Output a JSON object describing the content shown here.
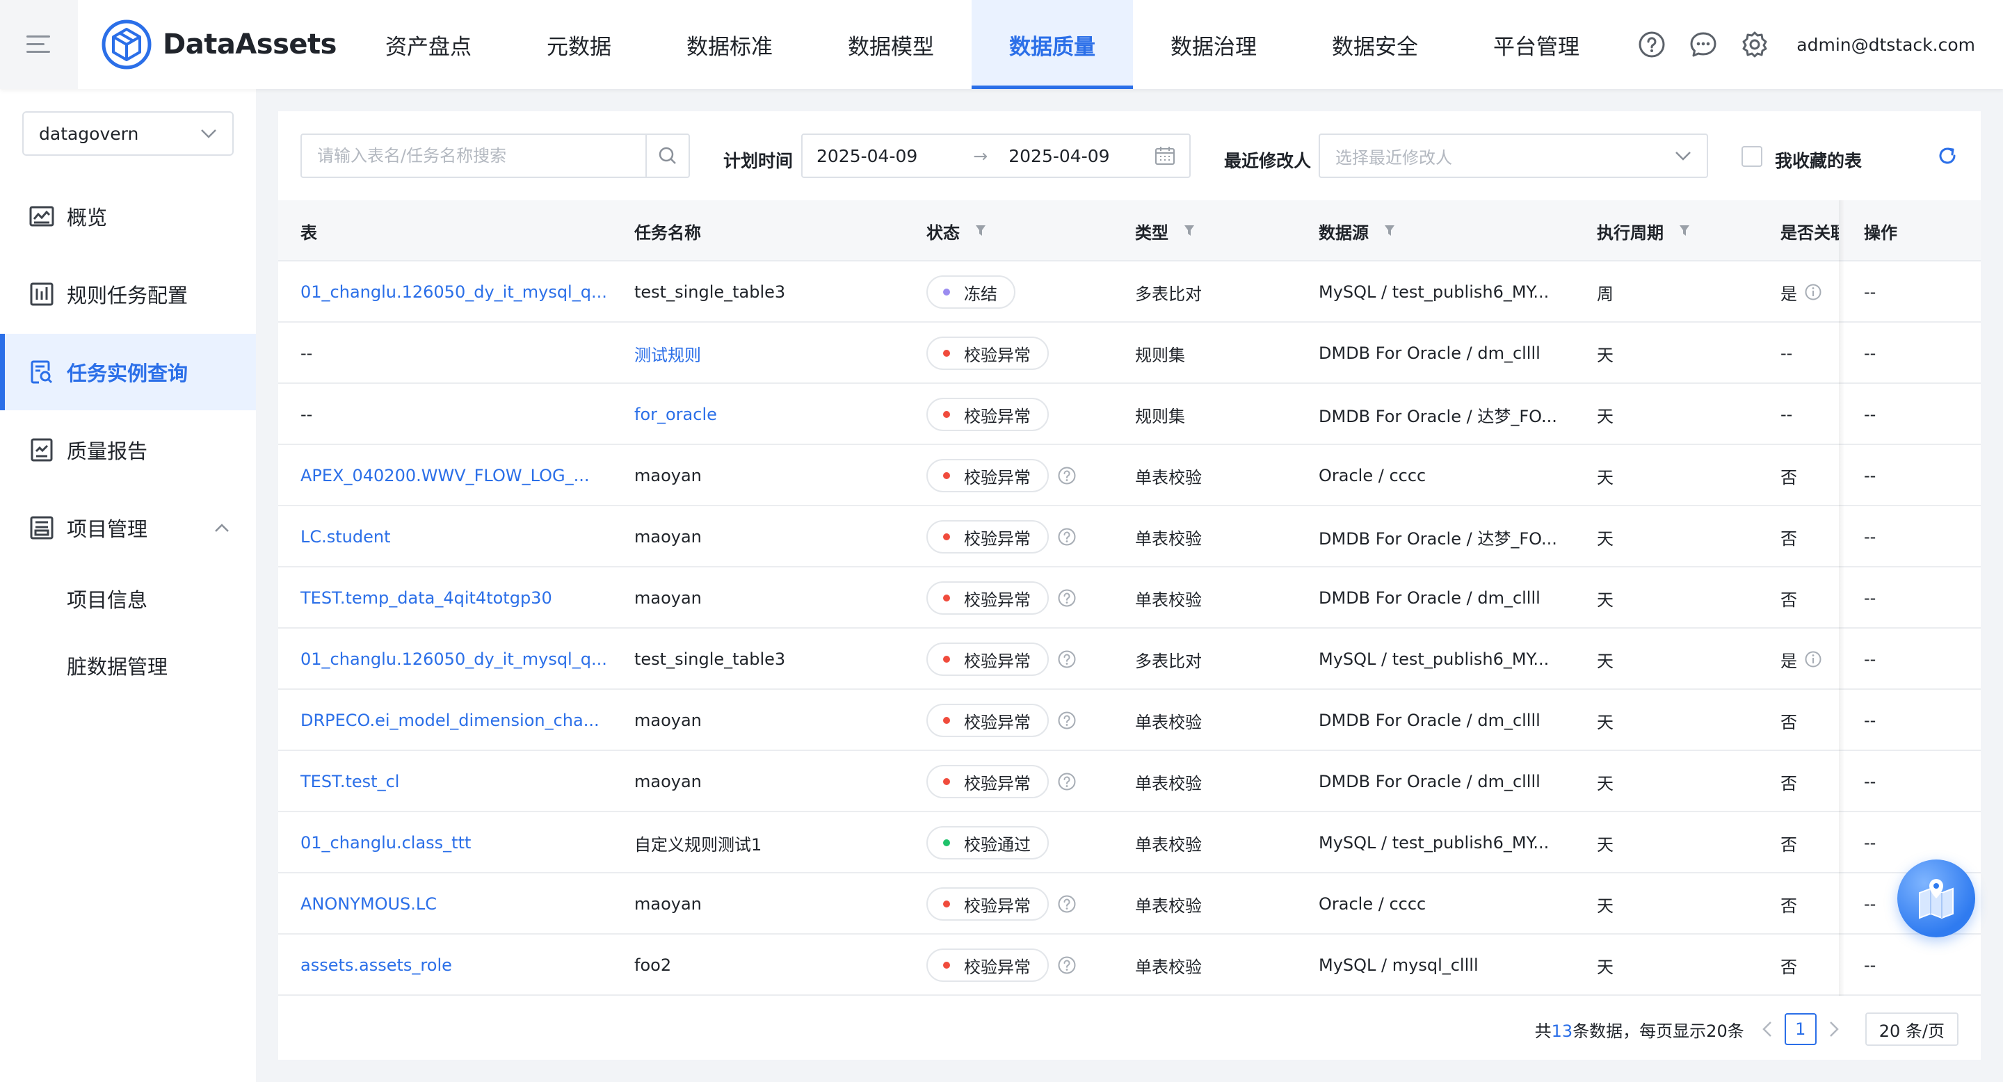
{
  "header": {
    "logo_text": "DataAssets",
    "nav": [
      {
        "label": "资产盘点"
      },
      {
        "label": "元数据"
      },
      {
        "label": "数据标准"
      },
      {
        "label": "数据模型"
      },
      {
        "label": "数据质量",
        "active": true
      },
      {
        "label": "数据治理"
      },
      {
        "label": "数据安全"
      },
      {
        "label": "平台管理"
      }
    ],
    "user_email": "admin@dtstack.com",
    "accent_color": "#2b6fe8"
  },
  "sidebar": {
    "project": "datagovern",
    "items": [
      {
        "label": "概览",
        "icon": "dashboard-icon"
      },
      {
        "label": "规则任务配置",
        "icon": "rules-icon"
      },
      {
        "label": "任务实例查询",
        "icon": "instance-search-icon",
        "active": true
      },
      {
        "label": "质量报告",
        "icon": "report-icon"
      },
      {
        "label": "项目管理",
        "icon": "project-icon",
        "expanded": true
      }
    ],
    "sub_items": [
      {
        "label": "项目信息"
      },
      {
        "label": "脏数据管理"
      }
    ]
  },
  "filters": {
    "search_placeholder": "请输入表名/任务名称搜索",
    "plan_time_label": "计划时间",
    "date_start": "2025-04-09",
    "date_end": "2025-04-09",
    "modifier_label": "最近修改人",
    "modifier_placeholder": "选择最近修改人",
    "favorites_label": "我收藏的表"
  },
  "table": {
    "columns": [
      "表",
      "任务名称",
      "状态",
      "类型",
      "数据源",
      "执行周期",
      "是否关联",
      "操作"
    ],
    "rows": [
      {
        "table": "01_changlu.126050_dy_it_mysql_q...",
        "table_link": true,
        "task": "test_single_table3",
        "task_link": false,
        "status": "冻结",
        "status_color": "#9b8cf0",
        "help": false,
        "type": "多表比对",
        "source": "MySQL / test_publish6_MY...",
        "cycle": "周",
        "related": "是",
        "related_info": true,
        "action": "--"
      },
      {
        "table": "--",
        "table_link": false,
        "task": "测试规则",
        "task_link": true,
        "status": "校验异常",
        "status_color": "#f04b3c",
        "help": false,
        "type": "规则集",
        "source": "DMDB For Oracle / dm_cllll",
        "cycle": "天",
        "related": "--",
        "related_info": false,
        "action": "--"
      },
      {
        "table": "--",
        "table_link": false,
        "task": "for_oracle",
        "task_link": true,
        "status": "校验异常",
        "status_color": "#f04b3c",
        "help": false,
        "type": "规则集",
        "source": "DMDB For Oracle / 达梦_FO...",
        "cycle": "天",
        "related": "--",
        "related_info": false,
        "action": "--"
      },
      {
        "table": "APEX_040200.WWV_FLOW_LOG_...",
        "table_link": true,
        "task": "maoyan",
        "task_link": false,
        "status": "校验异常",
        "status_color": "#f04b3c",
        "help": true,
        "type": "单表校验",
        "source": "Oracle / cccc",
        "cycle": "天",
        "related": "否",
        "related_info": false,
        "action": "--"
      },
      {
        "table": "LC.student",
        "table_link": true,
        "task": "maoyan",
        "task_link": false,
        "status": "校验异常",
        "status_color": "#f04b3c",
        "help": true,
        "type": "单表校验",
        "source": "DMDB For Oracle / 达梦_FO...",
        "cycle": "天",
        "related": "否",
        "related_info": false,
        "action": "--"
      },
      {
        "table": "TEST.temp_data_4qit4totgp30",
        "table_link": true,
        "task": "maoyan",
        "task_link": false,
        "status": "校验异常",
        "status_color": "#f04b3c",
        "help": true,
        "type": "单表校验",
        "source": "DMDB For Oracle / dm_cllll",
        "cycle": "天",
        "related": "否",
        "related_info": false,
        "action": "--"
      },
      {
        "table": "01_changlu.126050_dy_it_mysql_q...",
        "table_link": true,
        "task": "test_single_table3",
        "task_link": false,
        "status": "校验异常",
        "status_color": "#f04b3c",
        "help": true,
        "type": "多表比对",
        "source": "MySQL / test_publish6_MY...",
        "cycle": "天",
        "related": "是",
        "related_info": true,
        "action": "--"
      },
      {
        "table": "DRPECO.ei_model_dimension_cha...",
        "table_link": true,
        "task": "maoyan",
        "task_link": false,
        "status": "校验异常",
        "status_color": "#f04b3c",
        "help": true,
        "type": "单表校验",
        "source": "DMDB For Oracle / dm_cllll",
        "cycle": "天",
        "related": "否",
        "related_info": false,
        "action": "--"
      },
      {
        "table": "TEST.test_cl",
        "table_link": true,
        "task": "maoyan",
        "task_link": false,
        "status": "校验异常",
        "status_color": "#f04b3c",
        "help": true,
        "type": "单表校验",
        "source": "DMDB For Oracle / dm_cllll",
        "cycle": "天",
        "related": "否",
        "related_info": false,
        "action": "--"
      },
      {
        "table": "01_changlu.class_ttt",
        "table_link": true,
        "task": "自定义规则测试1",
        "task_link": false,
        "status": "校验通过",
        "status_color": "#1fc26b",
        "help": false,
        "type": "单表校验",
        "source": "MySQL / test_publish6_MY...",
        "cycle": "天",
        "related": "否",
        "related_info": false,
        "action": "--"
      },
      {
        "table": "ANONYMOUS.LC",
        "table_link": true,
        "task": "maoyan",
        "task_link": false,
        "status": "校验异常",
        "status_color": "#f04b3c",
        "help": true,
        "type": "单表校验",
        "source": "Oracle / cccc",
        "cycle": "天",
        "related": "否",
        "related_info": false,
        "action": "--"
      },
      {
        "table": "assets.assets_role",
        "table_link": true,
        "task": "foo2",
        "task_link": false,
        "status": "校验异常",
        "status_color": "#f04b3c",
        "help": true,
        "type": "单表校验",
        "source": "MySQL / mysql_cllll",
        "cycle": "天",
        "related": "否",
        "related_info": false,
        "action": "--"
      }
    ]
  },
  "pagination": {
    "total_prefix": "共",
    "total": "13",
    "total_suffix": "条数据，每页显示20条",
    "current_page": "1",
    "page_size": "20 条/页"
  }
}
